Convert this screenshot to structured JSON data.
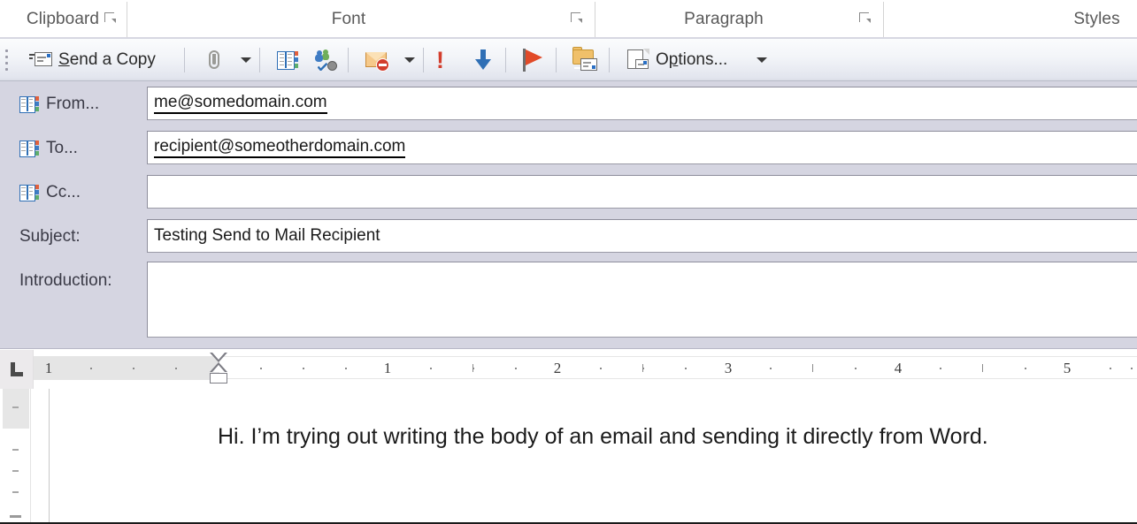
{
  "ribbon": {
    "groups": [
      {
        "label": "Clipboard",
        "has_launcher": true
      },
      {
        "label": "Font",
        "has_launcher": true
      },
      {
        "label": "Paragraph",
        "has_launcher": true
      },
      {
        "label": "Styles",
        "has_launcher": false
      }
    ]
  },
  "envelope_toolbar": {
    "send_label_prefix": "",
    "send_label_accel": "S",
    "send_label_rest": "end a Copy",
    "send_label_full": "Send a Copy",
    "options_accel_before": "O",
    "options_accel": "p",
    "options_rest": "tions...",
    "options_label_full": "Options...",
    "icons": [
      "send-a-copy-icon",
      "attach-file-icon",
      "attach-dropdown-caret",
      "address-book-icon",
      "check-names-icon",
      "do-not-deliver-icon",
      "do-not-deliver-caret",
      "high-importance-icon",
      "low-importance-icon",
      "follow-up-flag-icon",
      "save-sent-to-icon",
      "options-icon",
      "options-caret"
    ]
  },
  "envelope_header": {
    "fields": [
      {
        "name": "from",
        "label": "From...",
        "value": "me@somedomain.com",
        "resolved": true,
        "has_book_icon": true
      },
      {
        "name": "to",
        "label": "To...",
        "value": "recipient@someotherdomain.com",
        "resolved": true,
        "has_book_icon": true
      },
      {
        "name": "cc",
        "label": "Cc...",
        "value": "",
        "resolved": false,
        "has_book_icon": true
      },
      {
        "name": "subject",
        "label": "Subject:",
        "value": "Testing Send to Mail Recipient",
        "resolved": false,
        "has_book_icon": false
      },
      {
        "name": "introduction",
        "label": "Introduction:",
        "value": "",
        "resolved": false,
        "has_book_icon": false
      }
    ]
  },
  "ruler": {
    "tab_stop_type": "left-tab-stop",
    "numbers": [
      "1",
      "1",
      "2",
      "3",
      "4",
      "5"
    ],
    "unit": "inches"
  },
  "document": {
    "paragraph": "Hi. I’m trying out writing the body of an email and sending it directly from Word."
  },
  "colors": {
    "envelope_header_bg": "#d5d5e1",
    "toolbar_bg": "#eef0f5",
    "accent_red": "#d33d2c",
    "accent_blue": "#2f6fb5",
    "accent_green": "#6fae5a",
    "field_bg": "#ffffff",
    "ruler_margin": "#e5e5e5"
  }
}
